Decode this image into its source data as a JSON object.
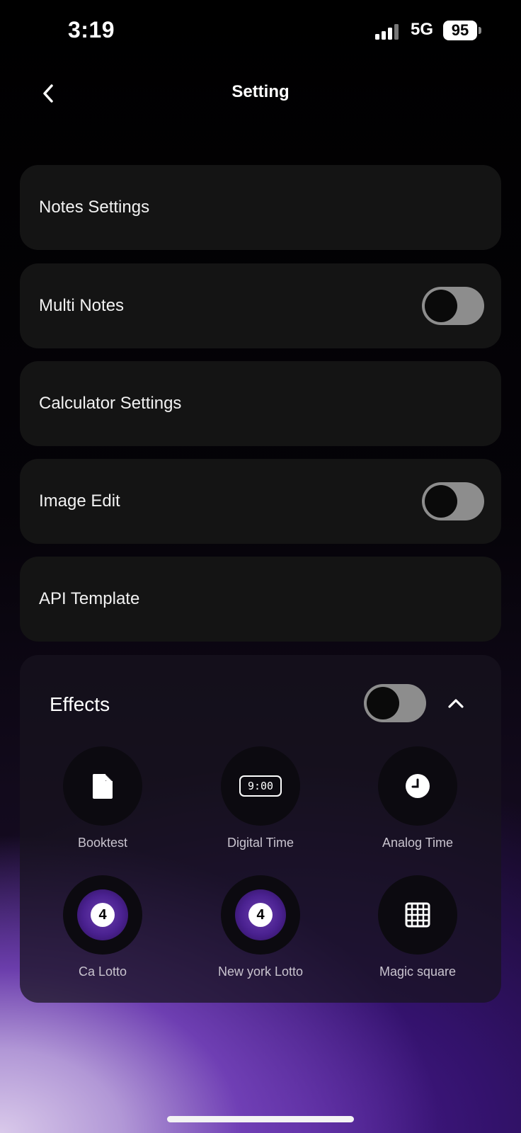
{
  "status_bar": {
    "time": "3:19",
    "network": "5G",
    "battery": "95"
  },
  "header": {
    "title": "Setting",
    "back_icon": "chevron-left-icon"
  },
  "settings": [
    {
      "label": "Notes Settings",
      "has_toggle": false
    },
    {
      "label": "Multi Notes",
      "has_toggle": true,
      "toggle_on": false
    },
    {
      "label": "Calculator Settings",
      "has_toggle": false
    },
    {
      "label": "Image Edit",
      "has_toggle": true,
      "toggle_on": false
    },
    {
      "label": "API Template",
      "has_toggle": false
    }
  ],
  "effects": {
    "title": "Effects",
    "toggle_on": false,
    "collapse_icon": "chevron-up-icon",
    "items": [
      {
        "label": "Booktest",
        "icon": "document-icon"
      },
      {
        "label": "Digital Time",
        "icon": "digital-clock-icon",
        "icon_text": "9:00"
      },
      {
        "label": "Analog Time",
        "icon": "analog-clock-icon"
      },
      {
        "label": "Ca Lotto",
        "icon": "lotto-ball-icon",
        "icon_text": "4"
      },
      {
        "label": "New york Lotto",
        "icon": "lotto-ball-icon",
        "icon_text": "4"
      },
      {
        "label": "Magic square",
        "icon": "grid-icon"
      }
    ]
  },
  "colors": {
    "card": "#141414",
    "toggle_off_track": "#8d8d8d",
    "accent_purple": "#4a1c8f"
  }
}
